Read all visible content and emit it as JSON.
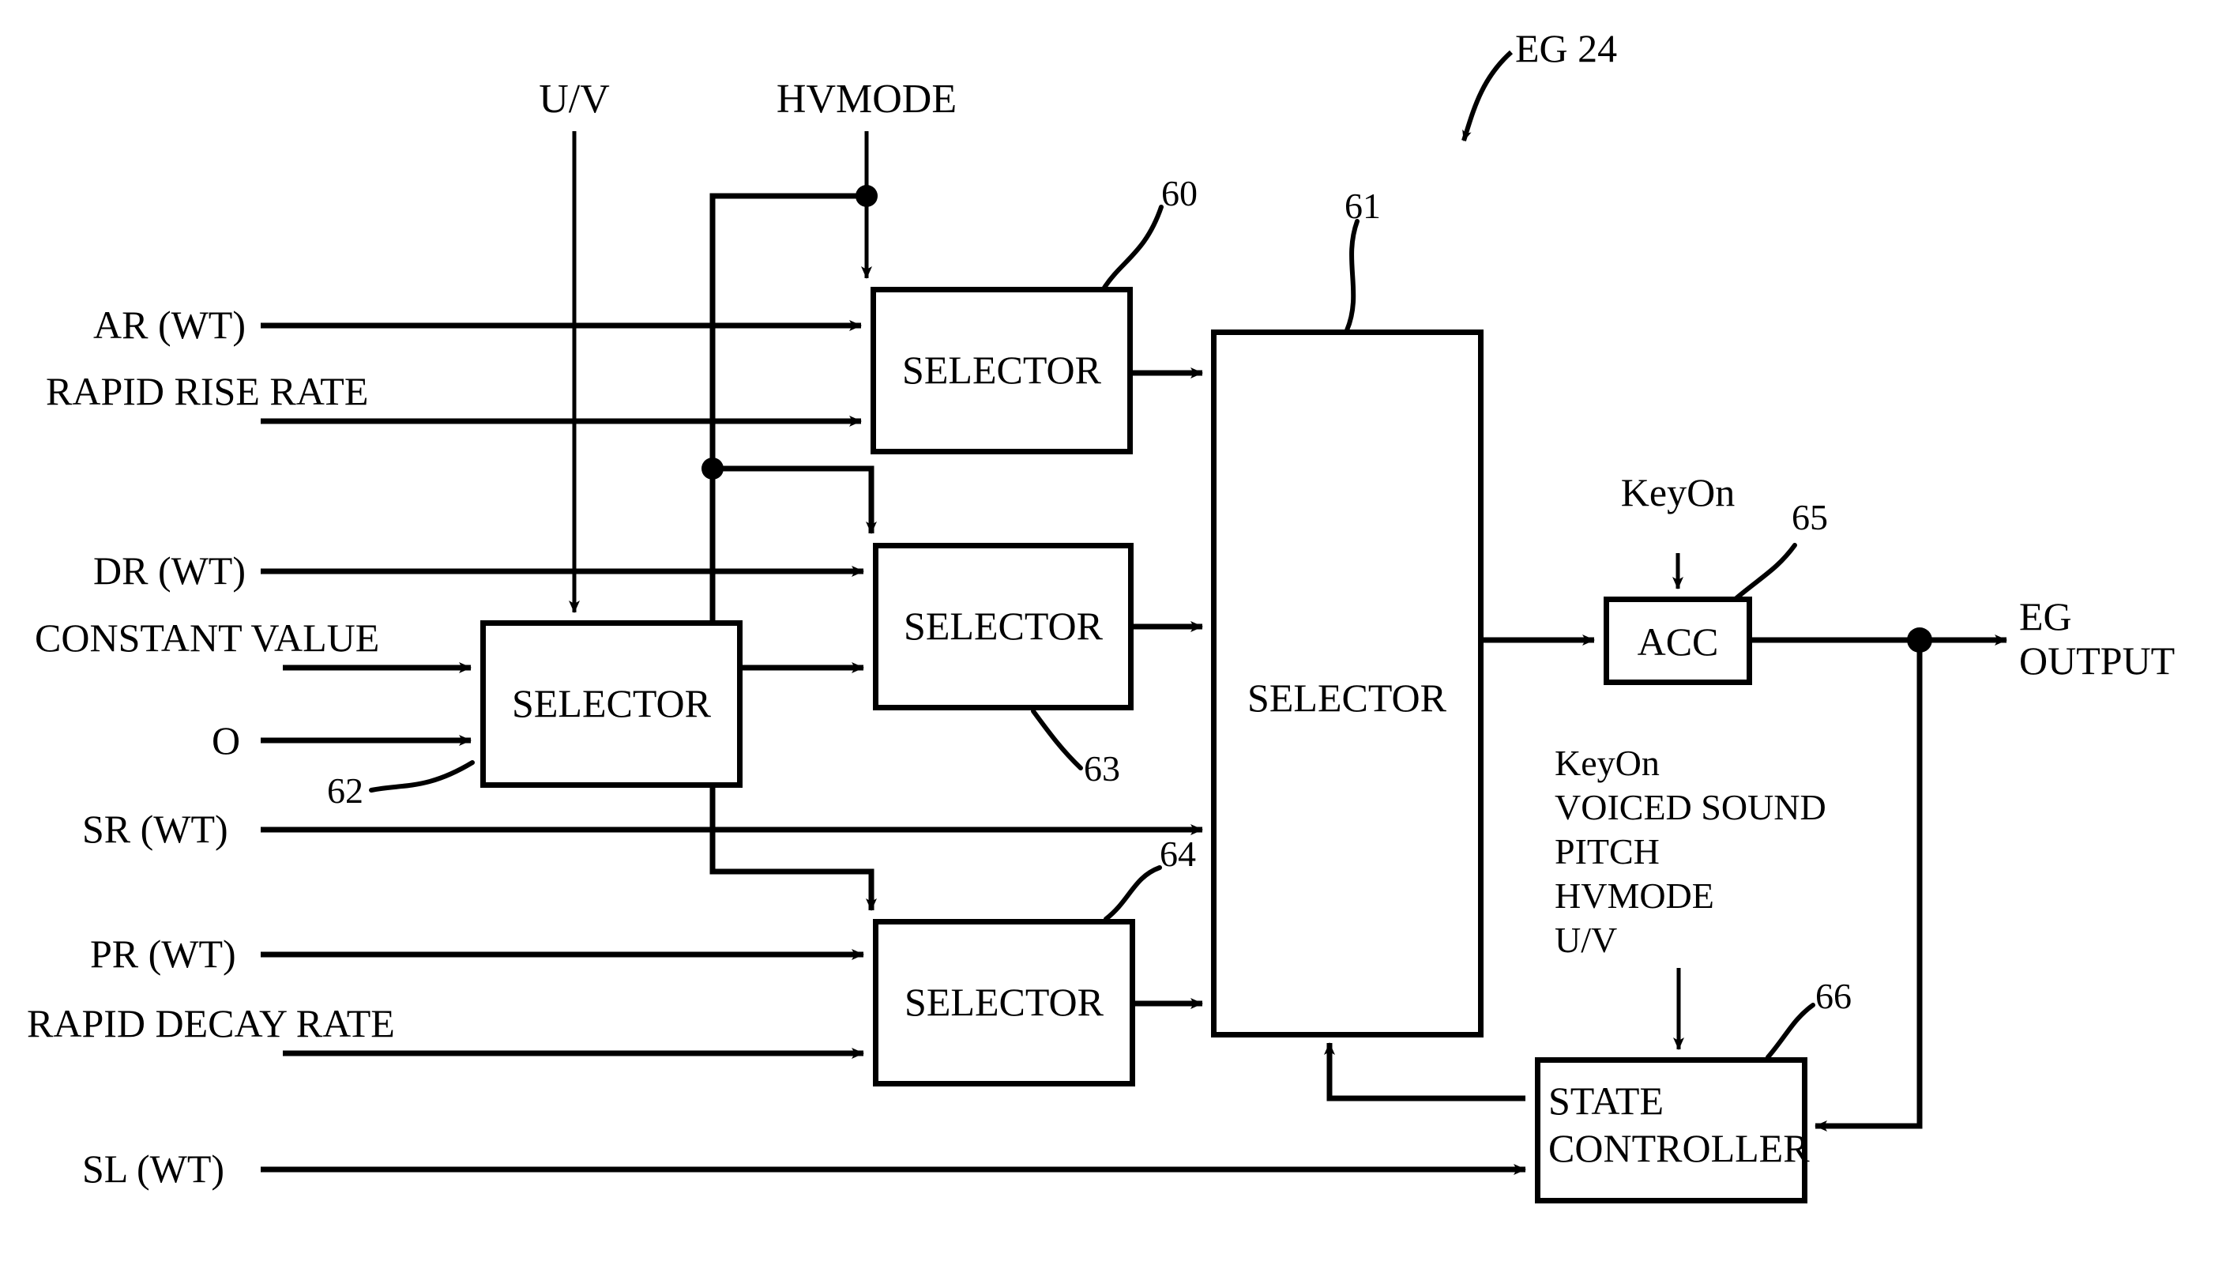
{
  "figure": {
    "reference_label": "EG 24",
    "inputs_left": [
      {
        "id": "ar_wt",
        "text": "AR (WT)"
      },
      {
        "id": "rapid_rise_rate",
        "text": "RAPID RISE RATE"
      },
      {
        "id": "dr_wt",
        "text": "DR (WT)"
      },
      {
        "id": "constant_value",
        "text": "CONSTANT VALUE"
      },
      {
        "id": "zero",
        "text": "O"
      },
      {
        "id": "sr_wt",
        "text": "SR (WT)"
      },
      {
        "id": "pr_wt",
        "text": "PR (WT)"
      },
      {
        "id": "rapid_decay_rate",
        "text": "RAPID DECAY RATE"
      },
      {
        "id": "sl_wt",
        "text": "SL (WT)"
      }
    ],
    "inputs_top": [
      {
        "id": "uv",
        "text": "U/V"
      },
      {
        "id": "hvmode",
        "text": "HVMODE"
      }
    ],
    "keyon_acc_label": "KeyOn",
    "state_controller_signals": [
      "KeyOn",
      "VOICED SOUND",
      "PITCH",
      "HVMODE",
      "U/V"
    ],
    "output": {
      "line1": "EG",
      "line2": "OUTPUT"
    },
    "blocks": [
      {
        "id": "sel60",
        "label": "SELECTOR",
        "ref": "60"
      },
      {
        "id": "sel61",
        "label": "SELECTOR",
        "ref": "61"
      },
      {
        "id": "sel62",
        "label": "SELECTOR",
        "ref": "62"
      },
      {
        "id": "sel63",
        "label": "SELECTOR",
        "ref": "63"
      },
      {
        "id": "sel64",
        "label": "SELECTOR",
        "ref": "64"
      },
      {
        "id": "acc65",
        "label": "ACC",
        "ref": "65"
      },
      {
        "id": "state66",
        "label_line1": "STATE",
        "label_line2": "CONTROLLER",
        "ref": "66"
      }
    ],
    "colors": {
      "stroke": "#000000",
      "background": "#ffffff"
    }
  }
}
